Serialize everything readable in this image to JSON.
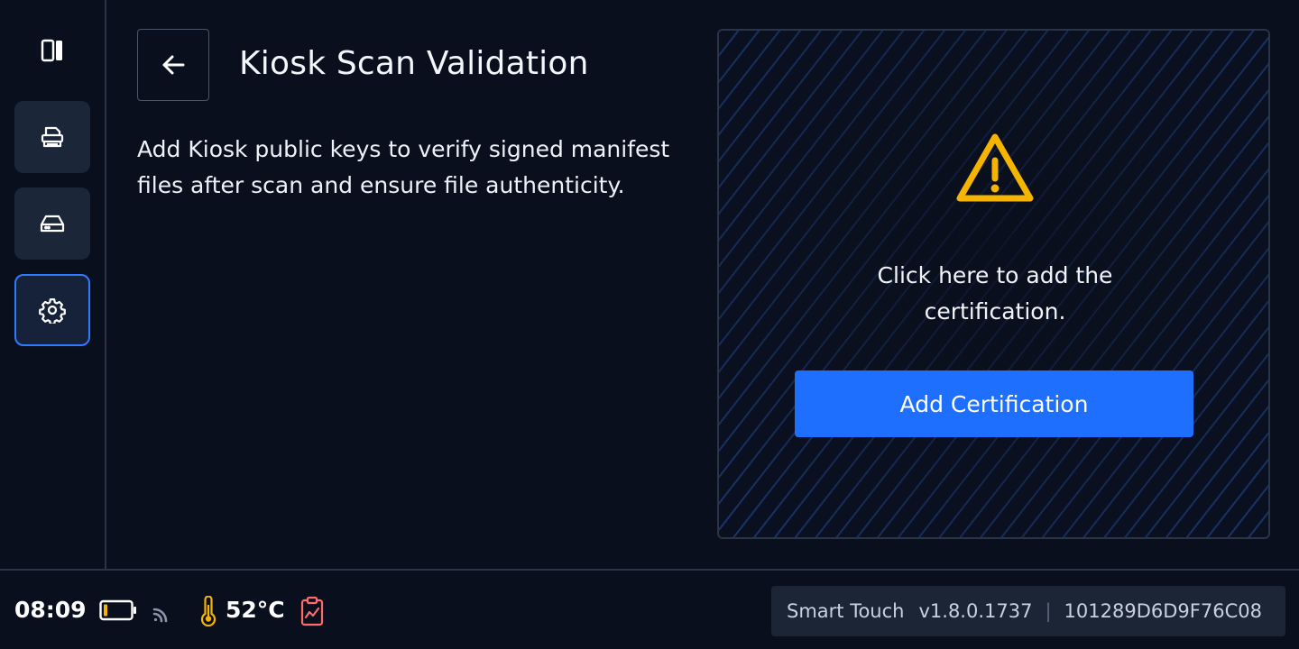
{
  "sidebar": {
    "toggle_icon": "panel-toggle-icon",
    "items": [
      {
        "name": "documents",
        "icon": "document-stack-icon",
        "active": false
      },
      {
        "name": "storage",
        "icon": "drive-icon",
        "active": false
      },
      {
        "name": "settings",
        "icon": "gear-icon",
        "active": true
      }
    ]
  },
  "header": {
    "back_icon": "arrow-left-icon",
    "title": "Kiosk Scan Validation"
  },
  "main": {
    "description": "Add Kiosk public keys to verify signed manifest files after scan and ensure file authenticity."
  },
  "cert_panel": {
    "icon": "warning-icon",
    "message": "Click here to add the certification.",
    "button_label": "Add Certification"
  },
  "status": {
    "time": "08:09",
    "battery_icon": "battery-low-icon",
    "signal_icon": "signal-icon",
    "thermometer_icon": "thermometer-icon",
    "temperature": "52°C",
    "diagnostics_icon": "clipboard-chart-icon",
    "product": "Smart Touch",
    "version": "v1.8.0.1737",
    "separator": "|",
    "device_id": "101289D6D9F76C08"
  },
  "colors": {
    "background": "#0a0f1d",
    "accent": "#1f6fff",
    "active_border": "#2e7bff",
    "warning": "#f5b400",
    "battery_level": "#f5b400",
    "diagnostics": "#ff6b6b"
  }
}
